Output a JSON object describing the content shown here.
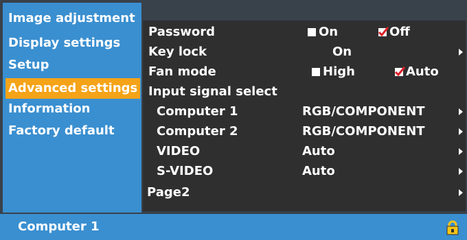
{
  "sidebar": {
    "items": [
      {
        "label": "Image adjustment"
      },
      {
        "label": "Display settings"
      },
      {
        "label": "Setup"
      },
      {
        "label": "Advanced settings"
      },
      {
        "label": "Information"
      },
      {
        "label": "Factory default"
      }
    ]
  },
  "panel": {
    "password": {
      "label": "Password",
      "on": "On",
      "off": "Off"
    },
    "keylock": {
      "label": "Key lock",
      "value": "On"
    },
    "fan": {
      "label": "Fan mode",
      "high": "High",
      "auto": "Auto"
    },
    "input": {
      "label": "Input signal select"
    },
    "computer1": {
      "label": "Computer 1",
      "value": "RGB/COMPONENT"
    },
    "computer2": {
      "label": "Computer 2",
      "value": "RGB/COMPONENT"
    },
    "video": {
      "label": "VIDEO",
      "value": "Auto"
    },
    "svideo": {
      "label": "S-VIDEO",
      "value": "Auto"
    },
    "page2": {
      "label": "Page2"
    }
  },
  "status": {
    "text": "Computer 1"
  },
  "colors": {
    "frame": "#39414a",
    "sidebar": "#3a8fd0",
    "selected": "#f5a318",
    "panel": "#2f2f2f",
    "check": "#e0202a"
  },
  "icons": {
    "lock": "padlock-icon"
  }
}
